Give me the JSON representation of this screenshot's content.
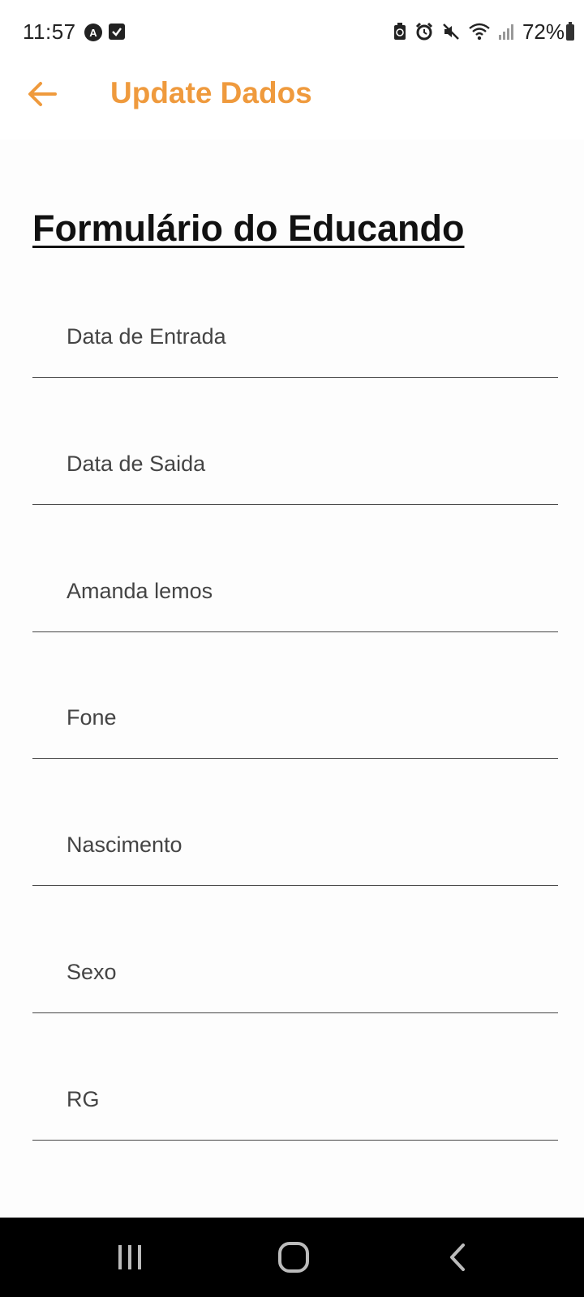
{
  "status_bar": {
    "time": "11:57",
    "battery_percent": "72%",
    "left_icons": [
      "auto-icon",
      "checkbox-icon"
    ],
    "right_icons": [
      "battery-saver-icon",
      "alarm-icon",
      "mute-icon",
      "wifi-icon",
      "signal-icon",
      "battery-icon"
    ]
  },
  "app_bar": {
    "title": "Update Dados",
    "accent_color": "#ef9a3d"
  },
  "form": {
    "title": "Formulário do Educando",
    "fields": [
      {
        "name": "data-entrada",
        "placeholder": "Data de Entrada",
        "value": ""
      },
      {
        "name": "data-saida",
        "placeholder": "Data de Saida",
        "value": ""
      },
      {
        "name": "nome",
        "placeholder": "Amanda lemos",
        "value": ""
      },
      {
        "name": "fone",
        "placeholder": "Fone",
        "value": ""
      },
      {
        "name": "nascimento",
        "placeholder": "Nascimento",
        "value": ""
      },
      {
        "name": "sexo",
        "placeholder": "Sexo",
        "value": ""
      },
      {
        "name": "rg",
        "placeholder": "RG",
        "value": ""
      }
    ]
  },
  "nav_bar": {
    "buttons": [
      "recents-icon",
      "home-icon",
      "back-icon"
    ]
  }
}
